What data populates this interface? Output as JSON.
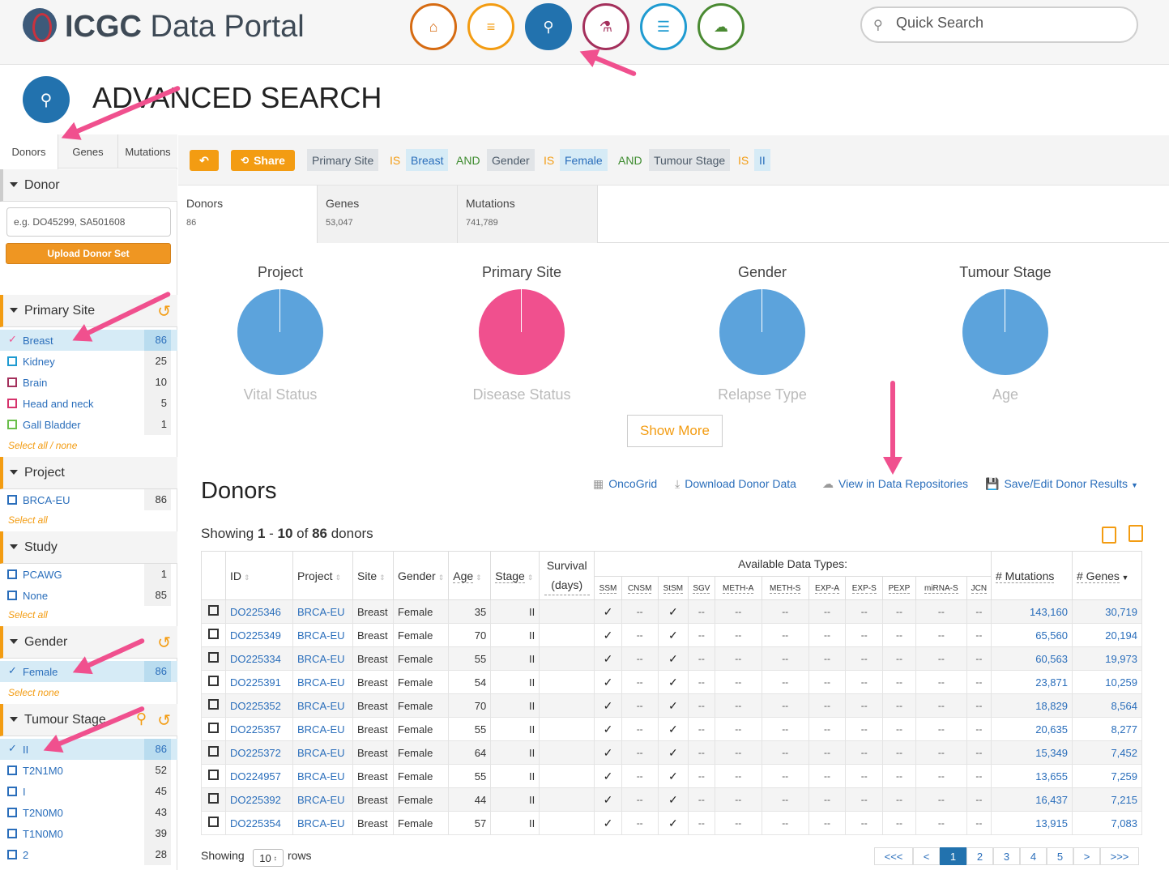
{
  "header": {
    "brand_bold": "ICGC",
    "brand_rest": " Data Portal",
    "nav": [
      {
        "name": "home",
        "color": "#d66b12"
      },
      {
        "name": "list",
        "color": "#f39c12"
      },
      {
        "name": "search",
        "color": "#2272ae"
      },
      {
        "name": "flask",
        "color": "#a4305c"
      },
      {
        "name": "database",
        "color": "#1f9bd1"
      },
      {
        "name": "cloud-download",
        "color": "#4a8a32"
      }
    ],
    "quick_search_placeholder": "Quick Search"
  },
  "page": {
    "title": "ADVANCED SEARCH"
  },
  "sidebar": {
    "tabs": [
      "Donors",
      "Genes",
      "Mutations"
    ],
    "donor_section": "Donor",
    "donor_input_placeholder": "e.g. DO45299, SA501608",
    "upload_label": "Upload Donor Set",
    "primary_site": {
      "title": "Primary Site",
      "terms": [
        {
          "name": "Breast",
          "count": "86",
          "selected": true,
          "color": "#f0508e"
        },
        {
          "name": "Kidney",
          "count": "25",
          "selected": false,
          "color": "#1f9bd1"
        },
        {
          "name": "Brain",
          "count": "10",
          "selected": false,
          "color": "#a4305c"
        },
        {
          "name": "Head and neck",
          "count": "5",
          "selected": false,
          "color": "#d6336c"
        },
        {
          "name": "Gall Bladder",
          "count": "1",
          "selected": false,
          "color": "#6abf4b"
        }
      ],
      "select": "Select all / none"
    },
    "project": {
      "title": "Project",
      "terms": [
        {
          "name": "BRCA-EU",
          "count": "86"
        }
      ],
      "select": "Select all"
    },
    "study": {
      "title": "Study",
      "terms": [
        {
          "name": "PCAWG",
          "count": "1"
        },
        {
          "name": "None",
          "count": "85"
        }
      ],
      "select": "Select all"
    },
    "gender": {
      "title": "Gender",
      "terms": [
        {
          "name": "Female",
          "count": "86"
        }
      ],
      "select": "Select none"
    },
    "tumour_stage": {
      "title": "Tumour Stage",
      "terms": [
        {
          "name": "II",
          "count": "86",
          "selected": true
        },
        {
          "name": "T2N1M0",
          "count": "52"
        },
        {
          "name": "I",
          "count": "45"
        },
        {
          "name": "T2N0M0",
          "count": "43"
        },
        {
          "name": "T1N0M0",
          "count": "39"
        },
        {
          "name": "2",
          "count": "28"
        }
      ]
    }
  },
  "query": {
    "share_label": "Share",
    "parts": [
      {
        "t": "field",
        "v": "Primary Site"
      },
      {
        "t": "op",
        "v": "IS"
      },
      {
        "t": "val",
        "v": "Breast"
      },
      {
        "t": "and",
        "v": "AND"
      },
      {
        "t": "field",
        "v": "Gender"
      },
      {
        "t": "op",
        "v": "IS"
      },
      {
        "t": "val",
        "v": "Female"
      },
      {
        "t": "and",
        "v": "AND"
      },
      {
        "t": "field",
        "v": "Tumour Stage"
      },
      {
        "t": "op",
        "v": "IS"
      },
      {
        "t": "val",
        "v": "II"
      }
    ]
  },
  "result_tabs": [
    {
      "label": "Donors",
      "count": "86"
    },
    {
      "label": "Genes",
      "count": "53,047"
    },
    {
      "label": "Mutations",
      "count": "741,789"
    }
  ],
  "pies": [
    {
      "title": "Project",
      "sub": "Vital Status",
      "color": "#5ca3dc"
    },
    {
      "title": "Primary Site",
      "sub": "Disease Status",
      "color": "#f0508e"
    },
    {
      "title": "Gender",
      "sub": "Relapse Type",
      "color": "#5ca3dc"
    },
    {
      "title": "Tumour Stage",
      "sub": "Age",
      "color": "#5ca3dc"
    }
  ],
  "show_more": "Show More",
  "donors": {
    "title": "Donors",
    "links": [
      "OncoGrid",
      "Download Donor Data",
      "View in Data Repositories",
      "Save/Edit Donor Results"
    ],
    "showing_pre": "Showing ",
    "showing_from": "1",
    "showing_dash": " - ",
    "showing_to": "10",
    "showing_of": " of ",
    "showing_total": "86",
    "showing_post": " donors",
    "columns": [
      "ID",
      "Project",
      "Site",
      "Gender",
      "Age",
      "Stage",
      "Survival (days)",
      "Available Data Types:",
      "# Mutations",
      "# Genes"
    ],
    "data_types": [
      "SSM",
      "CNSM",
      "StSM",
      "SGV",
      "METH-A",
      "METH-S",
      "EXP-A",
      "EXP-S",
      "PEXP",
      "miRNA-S",
      "JCN"
    ],
    "rows": [
      {
        "id": "DO225346",
        "project": "BRCA-EU",
        "site": "Breast",
        "gender": "Female",
        "age": "35",
        "stage": "II",
        "mut": "143,160",
        "genes": "30,719"
      },
      {
        "id": "DO225349",
        "project": "BRCA-EU",
        "site": "Breast",
        "gender": "Female",
        "age": "70",
        "stage": "II",
        "mut": "65,560",
        "genes": "20,194"
      },
      {
        "id": "DO225334",
        "project": "BRCA-EU",
        "site": "Breast",
        "gender": "Female",
        "age": "55",
        "stage": "II",
        "mut": "60,563",
        "genes": "19,973"
      },
      {
        "id": "DO225391",
        "project": "BRCA-EU",
        "site": "Breast",
        "gender": "Female",
        "age": "54",
        "stage": "II",
        "mut": "23,871",
        "genes": "10,259"
      },
      {
        "id": "DO225352",
        "project": "BRCA-EU",
        "site": "Breast",
        "gender": "Female",
        "age": "70",
        "stage": "II",
        "mut": "18,829",
        "genes": "8,564"
      },
      {
        "id": "DO225357",
        "project": "BRCA-EU",
        "site": "Breast",
        "gender": "Female",
        "age": "55",
        "stage": "II",
        "mut": "20,635",
        "genes": "8,277"
      },
      {
        "id": "DO225372",
        "project": "BRCA-EU",
        "site": "Breast",
        "gender": "Female",
        "age": "64",
        "stage": "II",
        "mut": "15,349",
        "genes": "7,452"
      },
      {
        "id": "DO224957",
        "project": "BRCA-EU",
        "site": "Breast",
        "gender": "Female",
        "age": "55",
        "stage": "II",
        "mut": "13,655",
        "genes": "7,259"
      },
      {
        "id": "DO225392",
        "project": "BRCA-EU",
        "site": "Breast",
        "gender": "Female",
        "age": "44",
        "stage": "II",
        "mut": "16,437",
        "genes": "7,215"
      },
      {
        "id": "DO225354",
        "project": "BRCA-EU",
        "site": "Breast",
        "gender": "Female",
        "age": "57",
        "stage": "II",
        "mut": "13,915",
        "genes": "7,083"
      }
    ],
    "type_marks": [
      "✓",
      "--",
      "✓",
      "--",
      "--",
      "--",
      "--",
      "--",
      "--",
      "--",
      "--"
    ]
  },
  "footer": {
    "showing": "Showing",
    "rows_value": "10",
    "rows_label": "rows",
    "pages": [
      "<<<",
      "<",
      "1",
      "2",
      "3",
      "4",
      "5",
      ">",
      ">>>"
    ],
    "current_page": "1"
  }
}
